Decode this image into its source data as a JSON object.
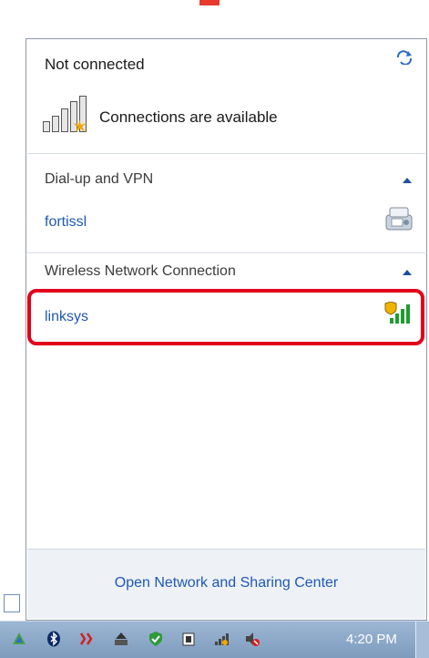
{
  "flyout": {
    "title": "Not connected",
    "status_icon": "network-bars-warning-icon",
    "status_text": "Connections are available",
    "groups": [
      {
        "label": "Dial-up and VPN",
        "chevron": "chevron-up-icon",
        "items": [
          {
            "name": "fortissl",
            "icon": "vpn-phone-icon"
          }
        ]
      },
      {
        "label": "Wireless Network Connection",
        "chevron": "chevron-up-icon",
        "items": [
          {
            "name": "linksys",
            "icon": "wifi-secure-signal-icon",
            "highlighted": true
          }
        ]
      }
    ],
    "footer_link": "Open Network and Sharing Center"
  },
  "taskbar": {
    "icons": [
      "upload-arrow-icon",
      "bluetooth-icon",
      "network-alert-icon",
      "eject-icon",
      "shield-icon",
      "power-icon",
      "network-icon",
      "volume-muted-icon"
    ],
    "clock": "4:20 PM"
  },
  "colors": {
    "link": "#1f57b5",
    "highlight": "#e3001b",
    "taskbar": "#8aa6c8"
  }
}
